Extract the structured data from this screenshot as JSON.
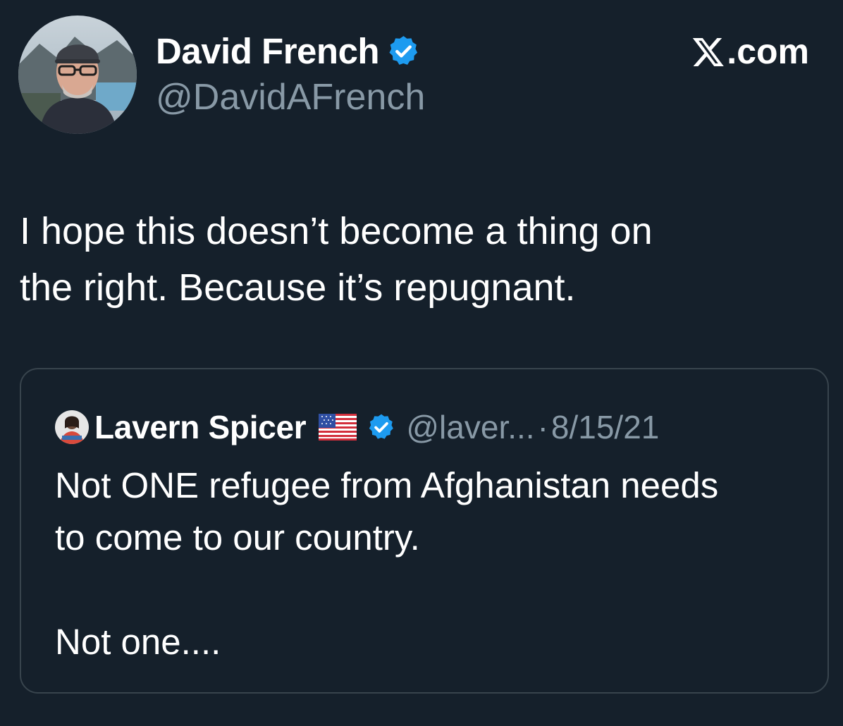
{
  "author": {
    "name": "David French",
    "handle": "@DavidAFrench",
    "avatar_icon": "avatar-photo",
    "verified_icon": "verified-badge-icon"
  },
  "brand": {
    "logo_icon": "x-logo-icon",
    "domain_suffix": ".com"
  },
  "tweet": {
    "text_line1": "I hope this doesn’t become a thing on",
    "text_line2": "the right. Because it’s repugnant."
  },
  "quoted_tweet": {
    "name": "Lavern Spicer",
    "flag_icon": "us-flag-icon",
    "verified_icon": "verified-badge-icon",
    "handle": "@laver...",
    "separator": "·",
    "date": "8/15/21",
    "text_line1": "Not ONE refugee from Afghanistan needs",
    "text_line2": "to come to our country.",
    "text_line3": "Not one...."
  },
  "colors": {
    "background": "#15202b",
    "text": "#ffffff",
    "secondary_text": "#8899a6",
    "verified_blue": "#1d9bf0",
    "card_border": "#38444d"
  }
}
